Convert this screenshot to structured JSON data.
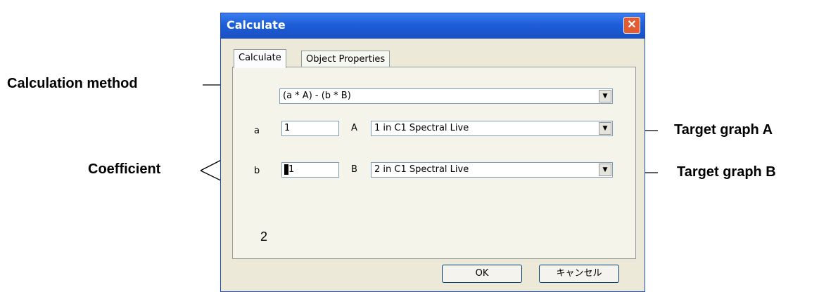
{
  "annotations": {
    "calculation_method": "Calculation method",
    "coefficient": "Coefficient",
    "target_a": "Target graph A",
    "target_b": "Target graph B"
  },
  "dialog": {
    "title": "Calculate",
    "close_symbol": "✕",
    "tabs": [
      {
        "label": "Calculate",
        "active": true
      },
      {
        "label": "Object Properties",
        "active": false
      }
    ],
    "method_value": "(a * A) - (b * B)",
    "rows": [
      {
        "coef_label": "a",
        "coef_value": "1",
        "target_label": "A",
        "target_value": "1 in C1 Spectral Live"
      },
      {
        "coef_label": "b",
        "coef_value": "1",
        "target_label": "B",
        "target_value": "2 in C1 Spectral Live"
      }
    ],
    "dropdown_arrow": "▼",
    "page_number": "2",
    "ok_label": "OK",
    "cancel_label": "キャンセル"
  }
}
